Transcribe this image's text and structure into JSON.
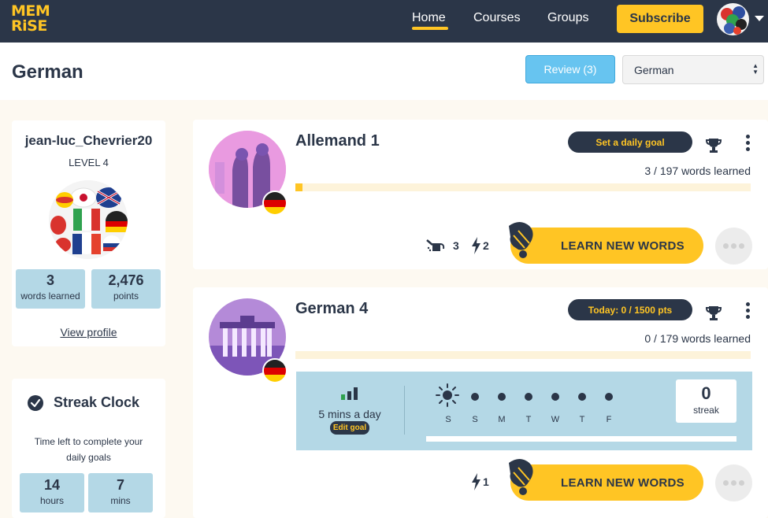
{
  "app": {
    "logo_text_line1": "MEM",
    "logo_text_line2": "RiSE"
  },
  "nav": {
    "home": "Home",
    "courses": "Courses",
    "groups": "Groups",
    "subscribe": "Subscribe"
  },
  "header": {
    "title": "German",
    "review_label": "Review (3)",
    "language_select": "German"
  },
  "profile": {
    "username": "jean-luc_Chevrier20",
    "level": "LEVEL 4",
    "words_value": "3",
    "words_label": "words learned",
    "points_value": "2,476",
    "points_label": "points",
    "view_profile": "View profile"
  },
  "streak_clock": {
    "title": "Streak Clock",
    "description": "Time left to complete your daily goals",
    "hours_value": "14",
    "hours_label": "hours",
    "mins_value": "7",
    "mins_label": "mins"
  },
  "courses": [
    {
      "title": "Allemand 1",
      "goal_pill": "Set a daily goal",
      "words_learned": "3 / 197 words learned",
      "progress_fraction": 0.0152,
      "metric_watering": "3",
      "metric_bolt": "2",
      "learn_label": "LEARN NEW WORDS"
    },
    {
      "title": "German 4",
      "goal_pill": "Today: 0 / 1500 pts",
      "words_learned": "0 / 179 words learned",
      "progress_fraction": 0,
      "goal_rate": "5 mins a day",
      "edit_goal": "Edit goal",
      "days": [
        "S",
        "S",
        "M",
        "T",
        "W",
        "T",
        "F"
      ],
      "streak_value": "0",
      "streak_label": "streak",
      "metric_bolt": "1",
      "learn_label": "LEARN NEW WORDS"
    }
  ],
  "colors": {
    "navy": "#2b3648",
    "accent_yellow": "#ffc524",
    "light_blue": "#b4d8e6",
    "review_blue": "#67c4f0",
    "background": "#fdf9f1"
  },
  "icons": [
    "trophy-icon",
    "kebab-icon",
    "watering-can-icon",
    "bolt-icon",
    "hand-icon",
    "sun-icon",
    "bars-icon",
    "check-icon",
    "flag-de-icon",
    "more-dots-icon"
  ]
}
